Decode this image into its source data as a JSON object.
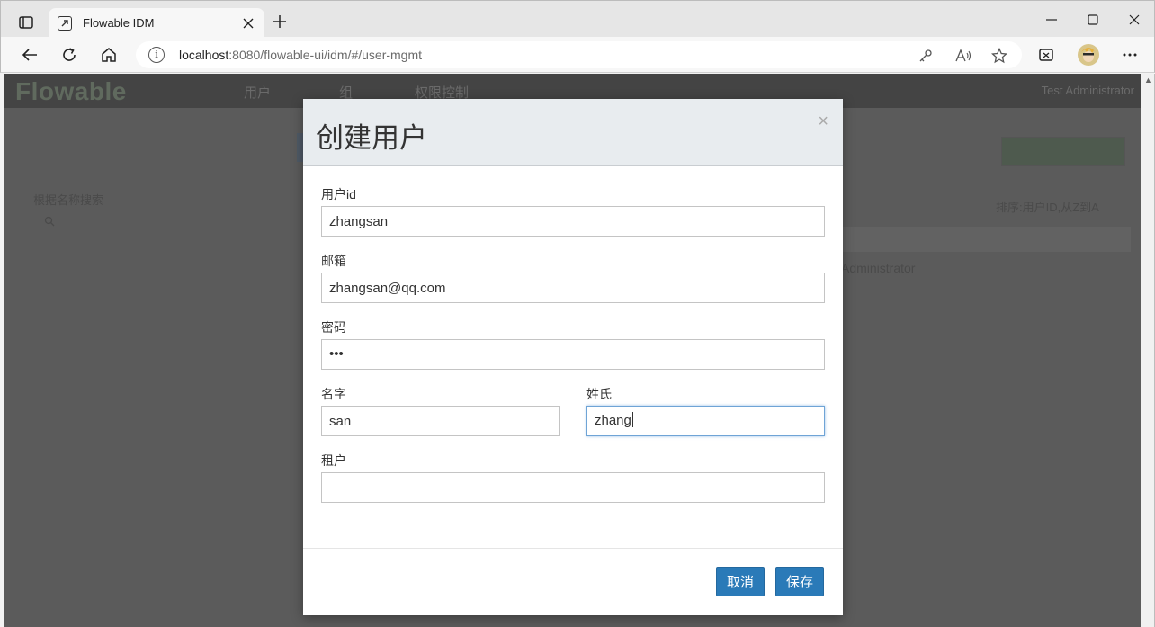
{
  "browser": {
    "tab_title": "Flowable IDM",
    "url_host": "localhost",
    "url_rest": ":8080/flowable-ui/idm/#/user-mgmt",
    "info_glyph": "i"
  },
  "app": {
    "logo": "Flowable",
    "nav": [
      "用户",
      "组",
      "权限控制"
    ],
    "user_menu": "Test Administrator",
    "side_label": "根据名称搜索",
    "sort_label": "排序:用户ID,从Z到A",
    "table_cell": "Administrator"
  },
  "modal": {
    "title": "创建用户",
    "close_glyph": "×",
    "fields": {
      "user_id": {
        "label": "用户id",
        "value": "zhangsan"
      },
      "email": {
        "label": "邮箱",
        "value": "zhangsan@qq.com"
      },
      "password": {
        "label": "密码",
        "value": "•••"
      },
      "first_name": {
        "label": "名字",
        "value": "san"
      },
      "last_name": {
        "label": "姓氏",
        "value": "zhang"
      },
      "tenant": {
        "label": "租户",
        "value": ""
      }
    },
    "cancel_label": "取消",
    "save_label": "保存"
  },
  "colors": {
    "primary_button": "#2a7ab8",
    "modal_header": "#e8ecef",
    "focus_border": "#6fa4d6"
  },
  "icons": [
    "tab-actions-icon",
    "favicon-icon",
    "close-tab-icon",
    "new-tab-icon",
    "minimize-icon",
    "maximize-icon",
    "close-window-icon",
    "back-icon",
    "refresh-icon",
    "home-icon",
    "info-icon",
    "key-icon",
    "read-aloud-icon",
    "favorite-star-icon",
    "collections-icon",
    "profile-avatar",
    "more-icon"
  ]
}
